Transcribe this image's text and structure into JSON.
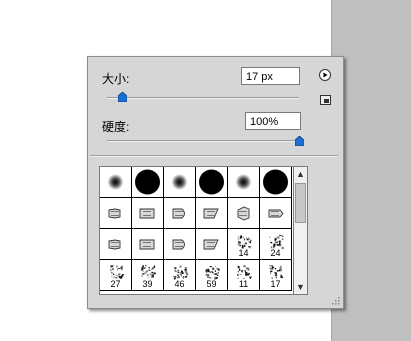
{
  "size": {
    "label": "大小:",
    "value": "17 px",
    "slider_fraction": 0.08
  },
  "hardness": {
    "label": "硬度:",
    "value": "100%",
    "slider_fraction": 1.0
  },
  "brushes": [
    {
      "type": "soft"
    },
    {
      "type": "hard"
    },
    {
      "type": "soft"
    },
    {
      "type": "hard"
    },
    {
      "type": "soft"
    },
    {
      "type": "hard"
    },
    {
      "type": "tool"
    },
    {
      "type": "tool"
    },
    {
      "type": "tool"
    },
    {
      "type": "tool"
    },
    {
      "type": "tool"
    },
    {
      "type": "tool"
    },
    {
      "type": "tool"
    },
    {
      "type": "tool"
    },
    {
      "type": "tool"
    },
    {
      "type": "tool"
    },
    {
      "type": "scatter",
      "num": "14"
    },
    {
      "type": "scatter",
      "num": "24"
    },
    {
      "type": "scatter",
      "num": "27"
    },
    {
      "type": "scatter",
      "num": "39"
    },
    {
      "type": "scatter",
      "num": "46"
    },
    {
      "type": "scatter",
      "num": "59"
    },
    {
      "type": "scatter",
      "num": "11"
    },
    {
      "type": "scatter",
      "num": "17"
    }
  ],
  "colors": {
    "thumb": "#1c6fd1",
    "panel": "#d6d6d6"
  }
}
